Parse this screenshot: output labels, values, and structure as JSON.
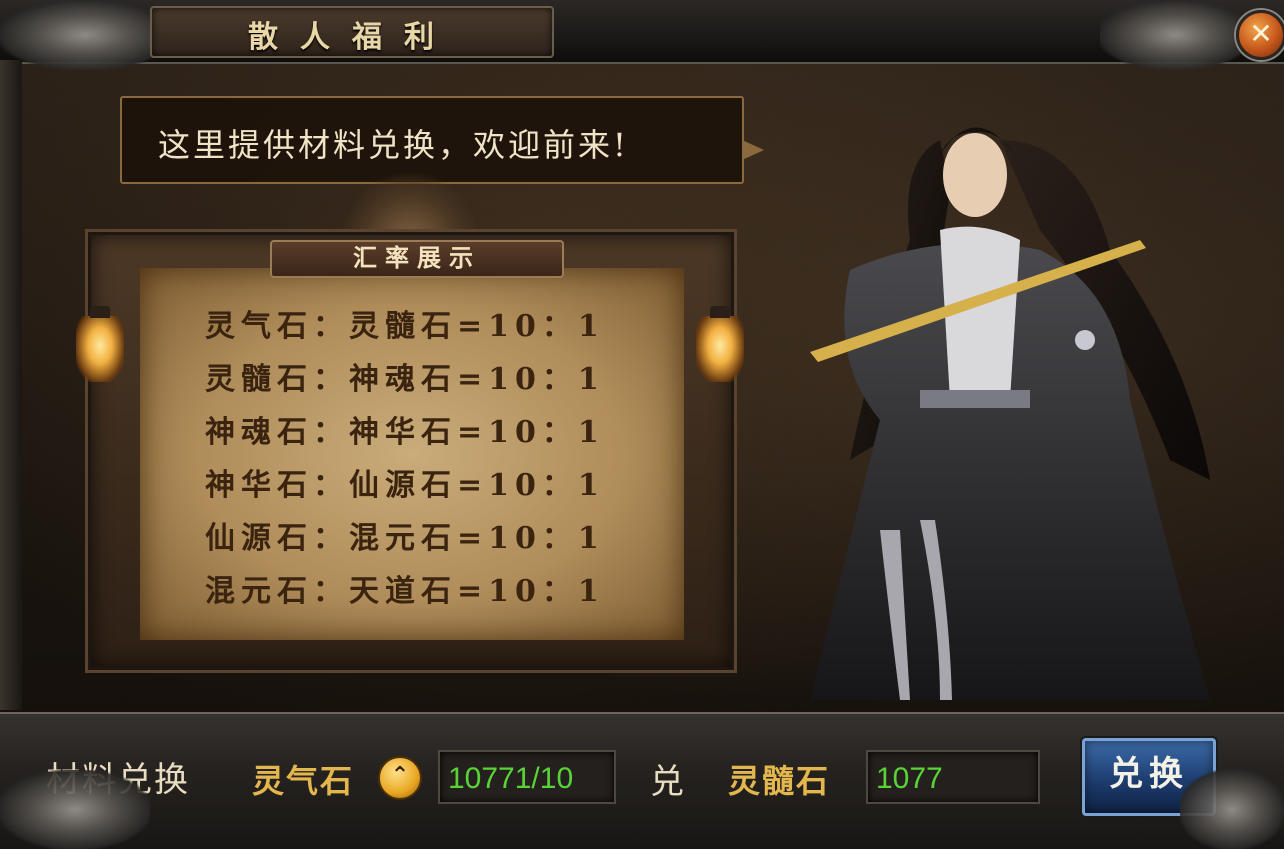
{
  "window": {
    "title": "散人福利",
    "close_label": "✕"
  },
  "npc": {
    "speech": "这里提供材料兑换，欢迎前来!"
  },
  "rate_board": {
    "title": "汇率展示",
    "rows": [
      "灵气石：灵髓石=10：1",
      "灵髓石：神魂石=10：1",
      "神魂石：神华石=10：1",
      "神华石：仙源石=10：1",
      "仙源石：混元石=10：1",
      "混元石：天道石=10：1"
    ]
  },
  "exchange": {
    "label": "材料兑换",
    "from_item": "灵气石",
    "toggle_symbol": "⌃",
    "from_value": "10771/10",
    "arrow_text": "兑",
    "to_item": "灵髓石",
    "to_value": "1077",
    "button_label": "兑换"
  },
  "colors": {
    "value_green": "#59d437",
    "item_gold": "#e3b64e",
    "button_blue": "#2a528c",
    "close_orange": "#c5561b"
  }
}
